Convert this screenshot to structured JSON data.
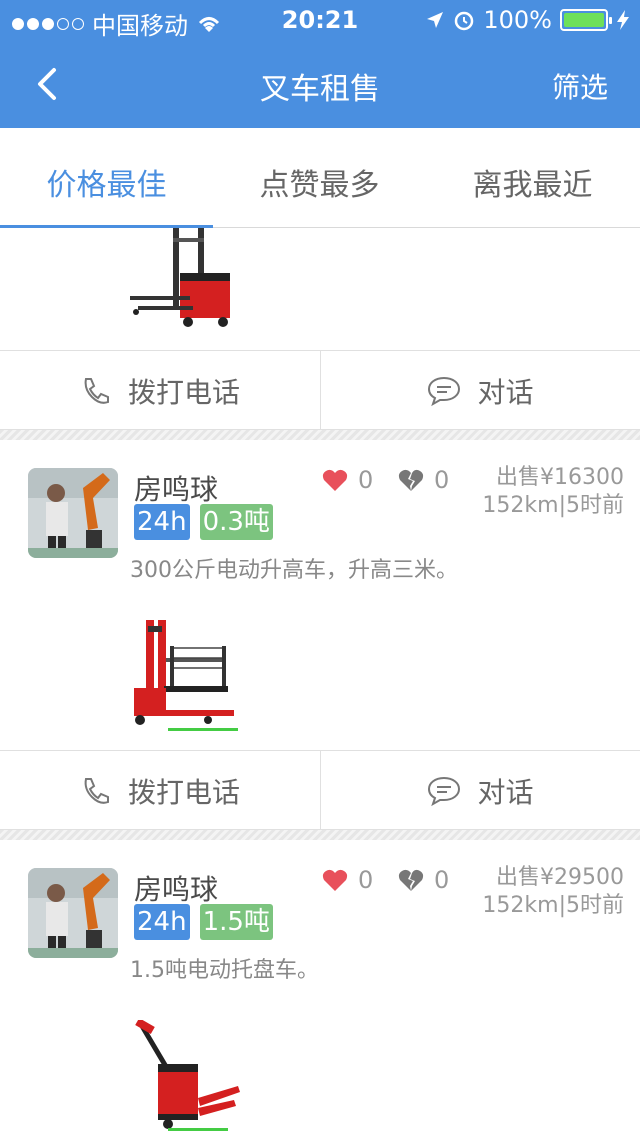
{
  "status_bar": {
    "carrier": "中国移动",
    "time": "20:21",
    "battery": "100%",
    "wifi_icon": "wifi-icon",
    "location_icon": "location-arrow-icon",
    "alarm_icon": "alarm-icon"
  },
  "nav": {
    "title": "叉车租售",
    "filter_label": "筛选",
    "back_icon": "chevron-left-icon"
  },
  "tabs": [
    {
      "label": "价格最佳",
      "active": true
    },
    {
      "label": "点赞最多",
      "active": false
    },
    {
      "label": "离我最近",
      "active": false
    }
  ],
  "actions": {
    "call_label": "拨打电话",
    "chat_label": "对话"
  },
  "listings": [
    {
      "seller": "房鸣球",
      "tags": [
        "24h",
        "0.3吨"
      ],
      "likes": "0",
      "dislikes": "0",
      "price": "出售¥16300",
      "distance_time": "152km|5时前",
      "description": "300公斤电动升高车，升高三米。"
    },
    {
      "seller": "房鸣球",
      "tags": [
        "24h",
        "1.5吨"
      ],
      "likes": "0",
      "dislikes": "0",
      "price": "出售¥29500",
      "distance_time": "152km|5时前",
      "description": "1.5吨电动托盘车。"
    }
  ],
  "colors": {
    "primary": "#4a8fe0",
    "tag_green": "#7cc47f",
    "heart_red": "#e8505b"
  }
}
